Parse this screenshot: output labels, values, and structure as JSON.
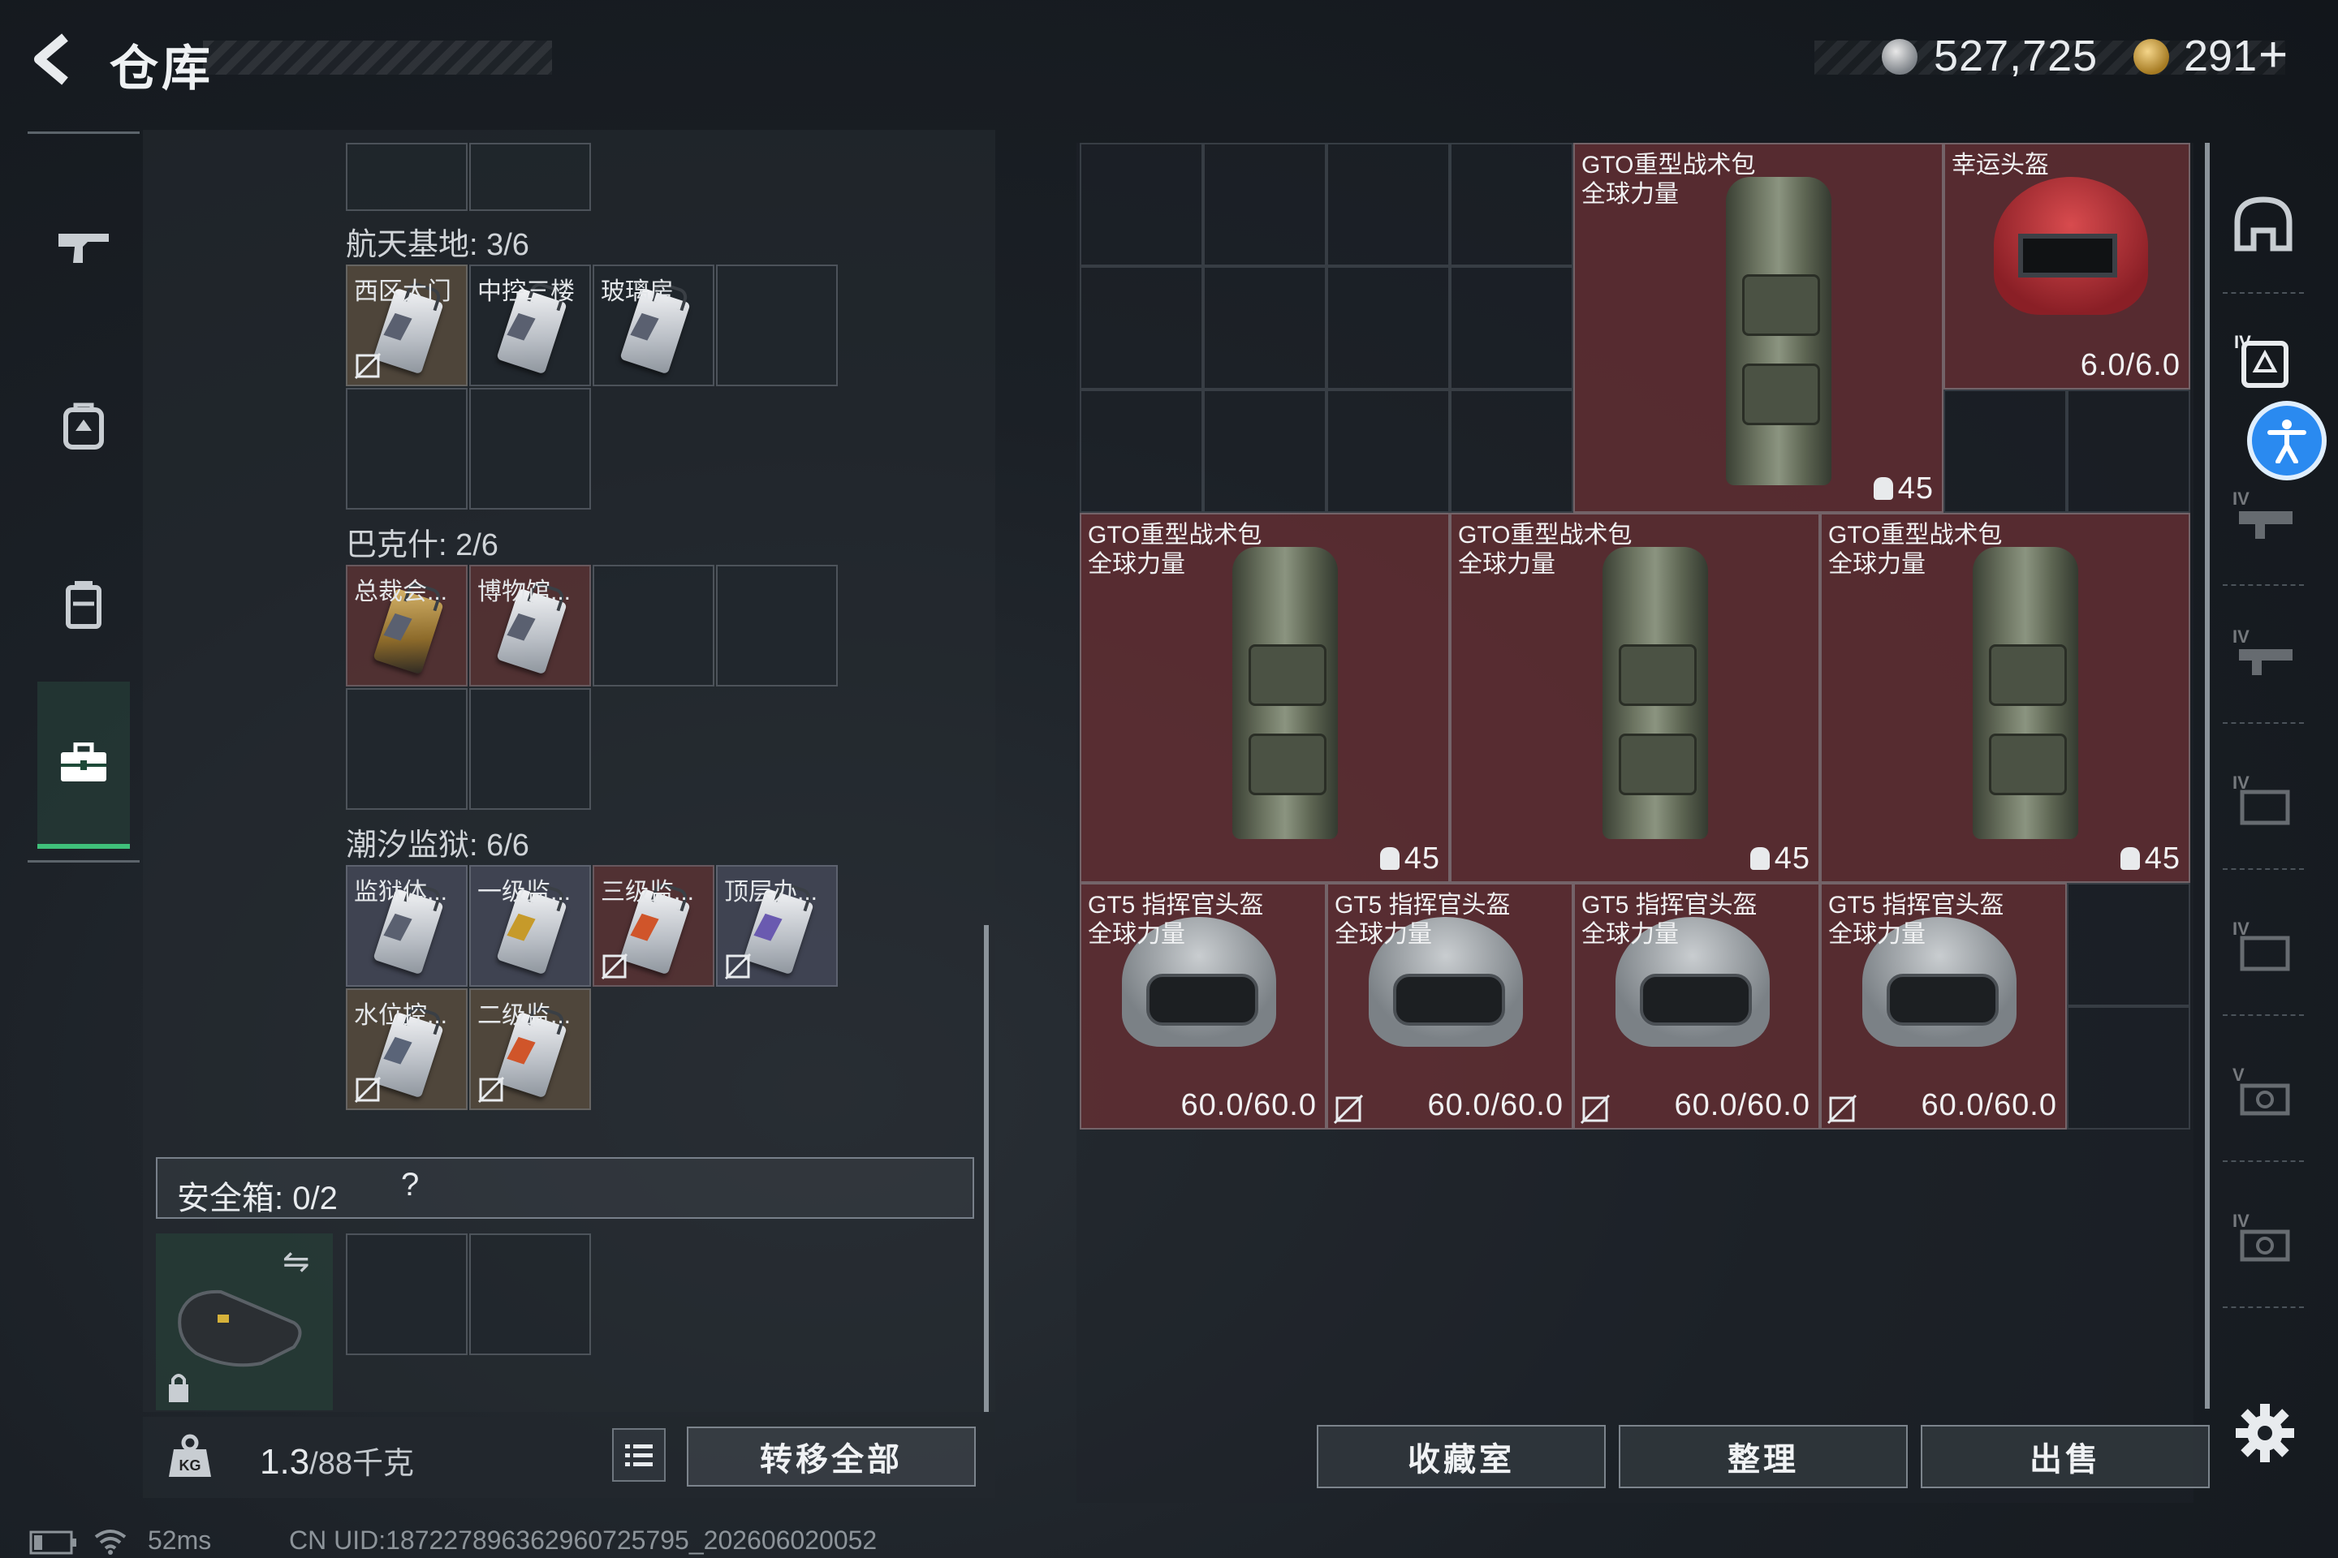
{
  "header": {
    "title": "仓库",
    "silver_amount": "527,725",
    "gold_amount": "291",
    "gold_plus": "+"
  },
  "left_nav": {
    "items": [
      "gun-icon",
      "armor-icon",
      "vest-icon",
      "toolbox-icon"
    ],
    "active": "toolbox-icon"
  },
  "keycard_sections": [
    {
      "label": "航天基地: 3/6",
      "cards": [
        "西区大门",
        "中控三楼",
        "玻璃房"
      ]
    },
    {
      "label": "巴克什: 2/6",
      "cards": [
        "总裁会...",
        "博物馆..."
      ]
    },
    {
      "label": "潮汐监狱: 6/6",
      "cards": [
        "监狱体...",
        "一级监...",
        "三级监...",
        "顶层办...",
        "水位控...",
        "二级监..."
      ]
    }
  ],
  "safe_box": {
    "label": "安全箱: 0/2",
    "help": "?",
    "swap_icon": "⇋"
  },
  "bottom_bar": {
    "weight": "1.3",
    "weight_unit": "/88千克",
    "transfer_all": "转移全部"
  },
  "grid_items": [
    {
      "name_line1": "GTO重型战术包",
      "name_line2": "全球力量",
      "stat": "45",
      "type": "backpack"
    },
    {
      "name_line1": "幸运头盔",
      "name_line2": "",
      "stat": "6.0/6.0",
      "type": "helmet-red"
    },
    {
      "name_line1": "GTO重型战术包",
      "name_line2": "全球力量",
      "stat": "45",
      "type": "backpack"
    },
    {
      "name_line1": "GTO重型战术包",
      "name_line2": "全球力量",
      "stat": "45",
      "type": "backpack"
    },
    {
      "name_line1": "GTO重型战术包",
      "name_line2": "全球力量",
      "stat": "45",
      "type": "backpack"
    },
    {
      "name_line1": "GT5 指挥官头盔",
      "name_line2": "全球力量",
      "stat": "60.0/60.0",
      "type": "helmet"
    },
    {
      "name_line1": "GT5 指挥官头盔",
      "name_line2": "全球力量",
      "stat": "60.0/60.0",
      "type": "helmet"
    },
    {
      "name_line1": "GT5 指挥官头盔",
      "name_line2": "全球力量",
      "stat": "60.0/60.0",
      "type": "helmet"
    },
    {
      "name_line1": "GT5 指挥官头盔",
      "name_line2": "全球力量",
      "stat": "60.0/60.0",
      "type": "helmet"
    }
  ],
  "right_nav": {
    "items": [
      "helmet-slot-icon",
      "armor-tier4-icon",
      "weapon-tier4-icon",
      "weapon-tier4-icon-2",
      "case-tier4-icon",
      "case-tier4-icon-2",
      "camera-tier5-icon",
      "camera-tier4-icon"
    ],
    "tier_labels": [
      "IV",
      "IV",
      "IV",
      "IV",
      "IV",
      "V",
      "IV"
    ]
  },
  "bottom_buttons": {
    "collection": "收藏室",
    "organize": "整理",
    "sell": "出售"
  },
  "status": {
    "ping": "52ms",
    "uid": "CN UID:18722789636296072579​5_202606020052"
  },
  "colors": {
    "accent_green": "#3fc07a",
    "item_red": "#6e3034",
    "accessibility_blue": "#2a8af0"
  }
}
